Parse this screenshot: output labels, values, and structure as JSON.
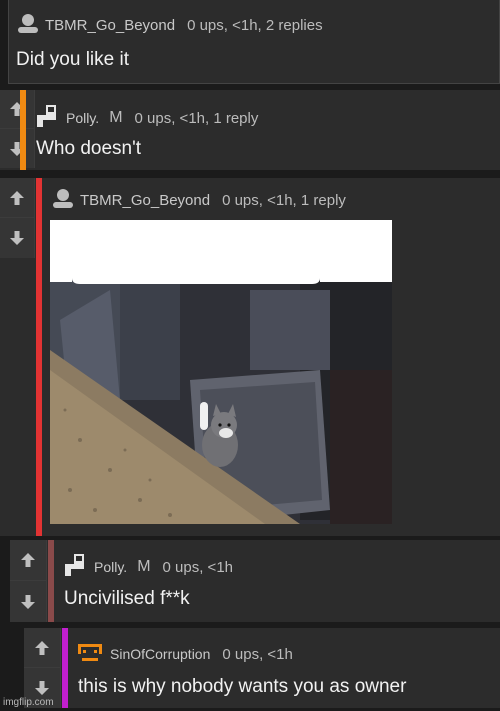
{
  "comments": [
    {
      "username": "TBMR_Go_Beyond",
      "stats": "0 ups, <1h, 2 replies",
      "text": "Did you like it",
      "accent": "#2a2a2a"
    },
    {
      "username": "Polly.",
      "flair": "M",
      "stats": "0 ups, <1h, 1 reply",
      "text": "Who doesn't",
      "accent": "#f08a12"
    },
    {
      "username": "TBMR_Go_Beyond",
      "stats": "0 ups, <1h, 1 reply",
      "text": "",
      "accent": "#e23333"
    },
    {
      "username": "Polly.",
      "flair": "M",
      "stats": "0 ups, <1h",
      "text": "Uncivilised f**k",
      "accent": "#8a4a4a"
    },
    {
      "username": "SinOfCorruption",
      "stats": "0 ups, <1h",
      "text": "this is why nobody wants you as owner",
      "accent": "#c21fcf"
    }
  ],
  "footer": "imgflip.com",
  "icons": {
    "up": "up-arrow-icon",
    "down": "down-arrow-icon",
    "avatar": "user-avatar-icon"
  }
}
